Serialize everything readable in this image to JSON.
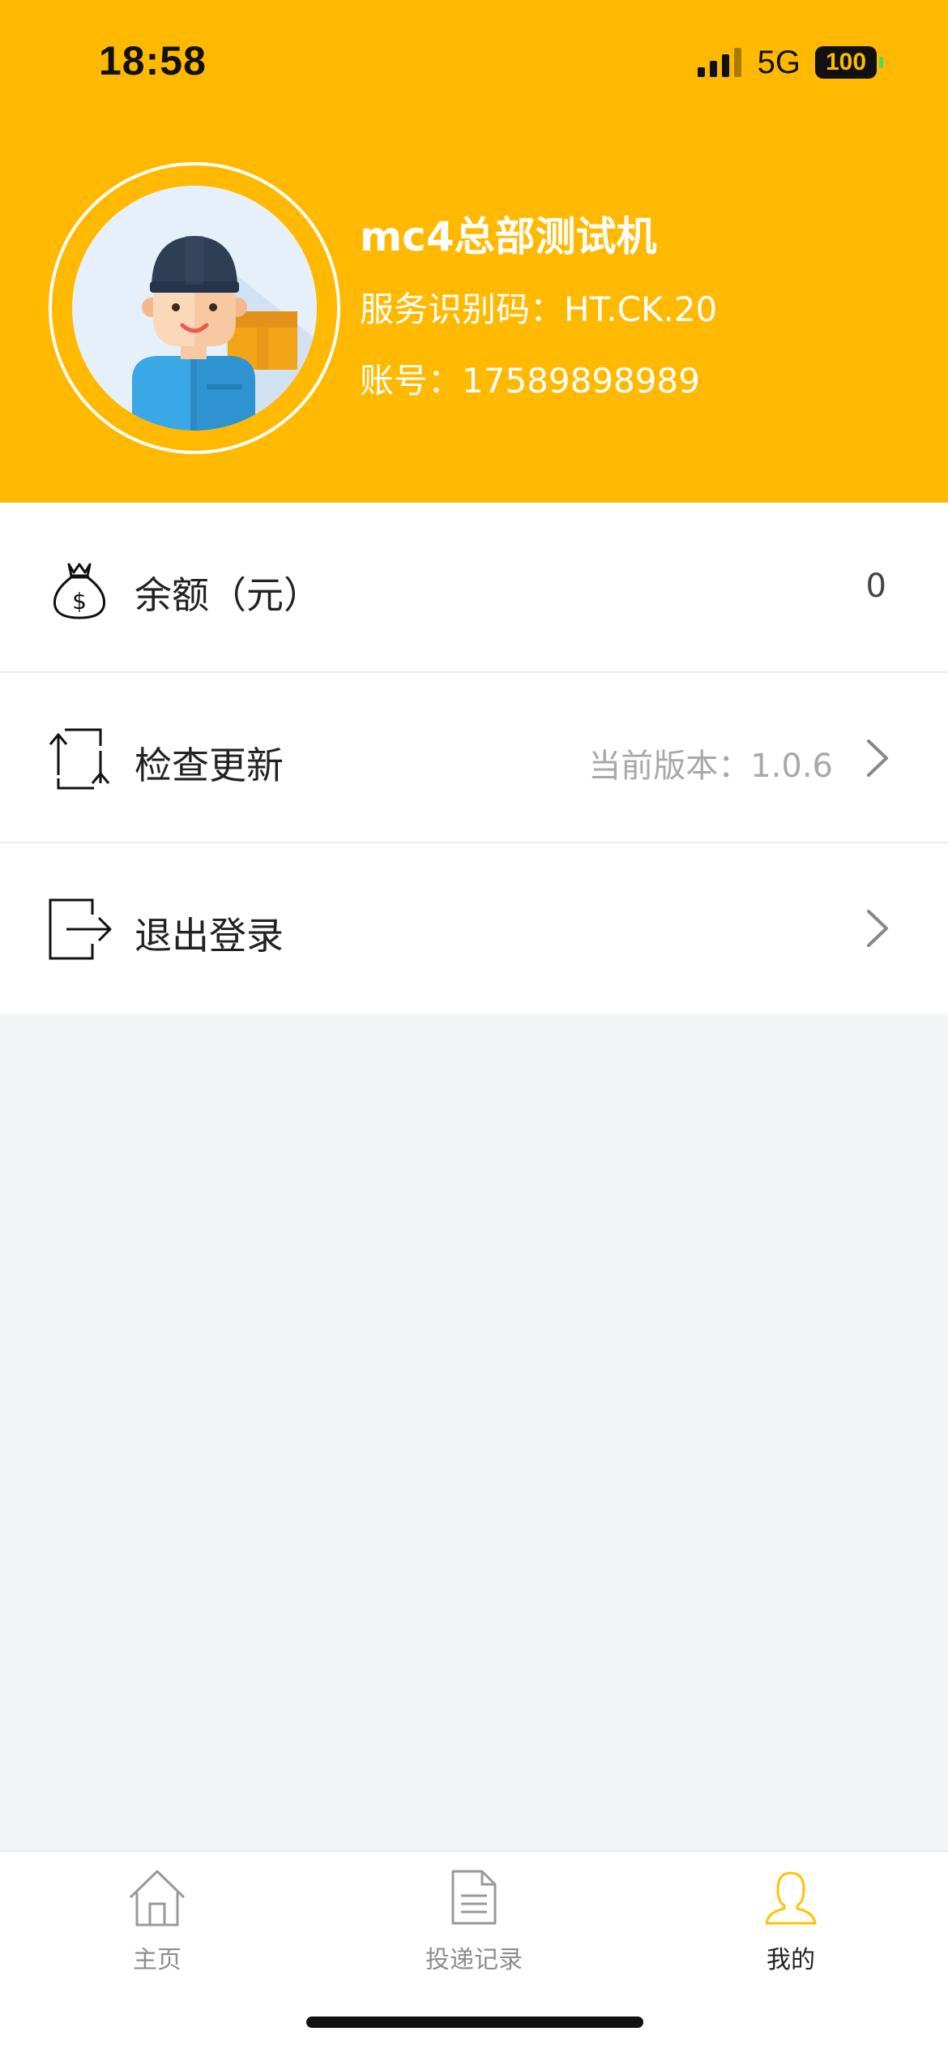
{
  "status_bar": {
    "time": "18:58",
    "network": "5G",
    "battery": "100"
  },
  "profile": {
    "name": "mc4总部测试机",
    "service_code": "服务识别码：HT.CK.20",
    "account": "账号：17589898989"
  },
  "menu": {
    "balance": {
      "label": "余额（元）",
      "value": "0",
      "icon": "money-bag-icon"
    },
    "update": {
      "label": "检查更新",
      "sub": "当前版本：1.0.6",
      "icon": "refresh-icon"
    },
    "logout": {
      "label": "退出登录",
      "icon": "logout-icon"
    }
  },
  "tabbar": {
    "tabs": [
      {
        "label": "主页",
        "icon": "home-icon",
        "active": false
      },
      {
        "label": "投递记录",
        "icon": "document-icon",
        "active": false
      },
      {
        "label": "我的",
        "icon": "user-icon",
        "active": true
      }
    ]
  },
  "colors": {
    "brand": "#ffb900",
    "background": "#f3f4f6",
    "active_tab_icon": "#ffc400"
  }
}
